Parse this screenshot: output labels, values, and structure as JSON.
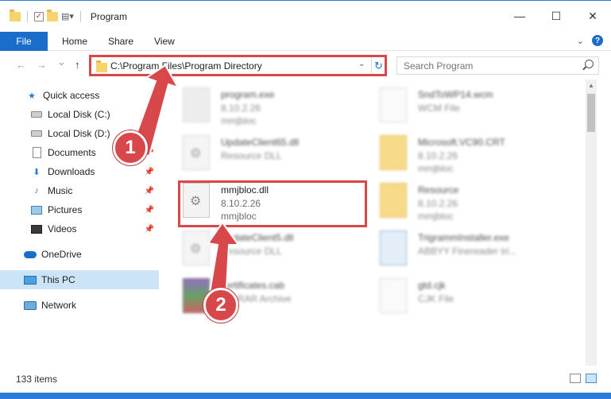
{
  "window": {
    "title": "Program",
    "minimize": "—",
    "maximize": "☐",
    "close": "✕"
  },
  "ribbon": {
    "tabs": [
      "File",
      "Home",
      "Share",
      "View"
    ]
  },
  "nav": {
    "back": "←",
    "forward": "→",
    "recent": "⌄",
    "up": "↑",
    "address": "C:\\Program Files\\Program Directory",
    "search_placeholder": "Search Program"
  },
  "sidebar": {
    "items": [
      {
        "label": "Quick access",
        "icon": "star-icon",
        "pinned": false
      },
      {
        "label": "Local Disk (C:)",
        "icon": "disk-icon",
        "pinned": true
      },
      {
        "label": "Local Disk (D:)",
        "icon": "disk-icon",
        "pinned": true
      },
      {
        "label": "Documents",
        "icon": "documents-icon",
        "pinned": true
      },
      {
        "label": "Downloads",
        "icon": "downloads-icon",
        "pinned": true
      },
      {
        "label": "Music",
        "icon": "music-icon",
        "pinned": true
      },
      {
        "label": "Pictures",
        "icon": "pictures-icon",
        "pinned": true
      },
      {
        "label": "Videos",
        "icon": "videos-icon",
        "pinned": true
      },
      {
        "label": "OneDrive",
        "icon": "onedrive-icon",
        "pinned": false
      },
      {
        "label": "This PC",
        "icon": "this-pc-icon",
        "pinned": false,
        "selected": true
      },
      {
        "label": "Network",
        "icon": "network-icon",
        "pinned": false
      }
    ]
  },
  "files": [
    {
      "name": "program.exe",
      "line2": "8.10.2.26",
      "line3": "mmjbloc",
      "type": "exe"
    },
    {
      "name": "SndToWP14.wcm",
      "line2": "WCM File",
      "line3": "",
      "type": "wcm"
    },
    {
      "name": "UpdateClient65.dll",
      "line2": "Resource DLL",
      "line3": "",
      "type": "dll"
    },
    {
      "name": "Microsoft.VC90.CRT",
      "line2": "8.10.2.26",
      "line3": "mmjbloc",
      "type": "folder"
    },
    {
      "name": "mmjbloc.dll",
      "line2": "8.10.2.26",
      "line3": "mmjbloc",
      "type": "dll"
    },
    {
      "name": "Resource",
      "line2": "8.10.2.26",
      "line3": "mmjbloc",
      "type": "folder"
    },
    {
      "name": "UpdateClient5.dll",
      "line2": "Resource DLL",
      "line3": "",
      "type": "dll"
    },
    {
      "name": "TrigrammInstaller.exe",
      "line2": "ABBYY Finereader tri...",
      "line3": "",
      "type": "installer"
    },
    {
      "name": "certificates.cab",
      "line2": "WinRAR Archive",
      "line3": "",
      "type": "cab"
    },
    {
      "name": "gtd.cjk",
      "line2": "CJK File",
      "line3": "",
      "type": "cjk"
    }
  ],
  "callouts": [
    "1",
    "2"
  ],
  "status": {
    "item_count": "133 items"
  },
  "colors": {
    "accent": "#1a6ec9",
    "highlight": "#d8474a",
    "selection": "#cce4f7"
  }
}
